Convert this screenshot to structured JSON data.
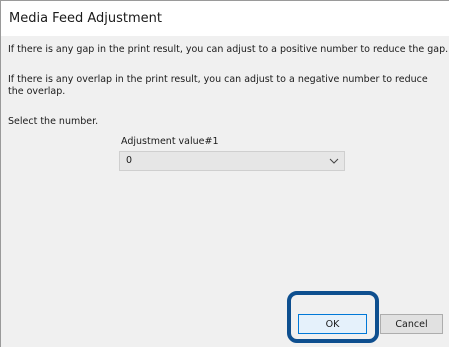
{
  "window": {
    "title": "Media Feed Adjustment"
  },
  "messages": {
    "gap": "If there is any gap in the print result, you can adjust to a positive number to reduce the gap.",
    "overlap": "If there is any overlap in the print result, you can adjust to a negative number to reduce the overlap.",
    "select": "Select the number."
  },
  "adjustment": {
    "label": "Adjustment value#1",
    "value": "0",
    "dropdown_icon": "chevron-down-icon"
  },
  "buttons": {
    "ok_label": "OK",
    "cancel_label": "Cancel"
  },
  "colors": {
    "highlight": "#0e4f8f",
    "ok_border": "#0078d7"
  }
}
